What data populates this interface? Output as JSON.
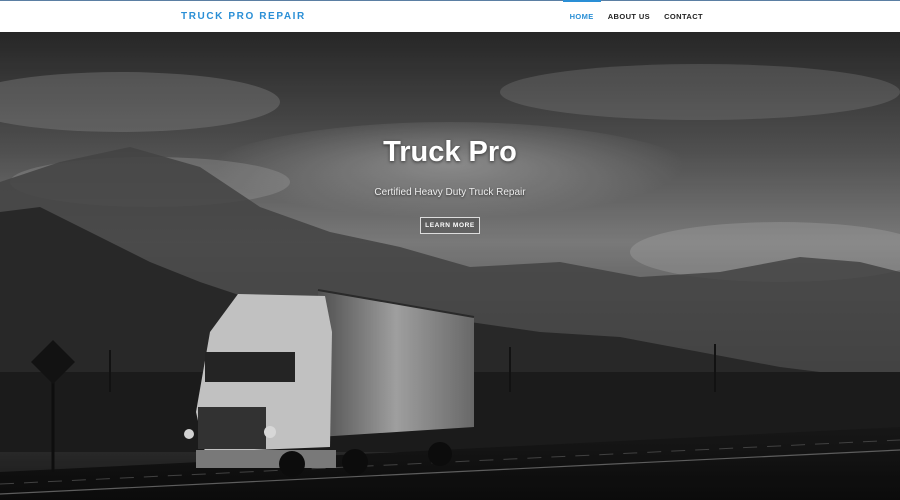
{
  "header": {
    "brand": "TRUCK PRO REPAIR",
    "nav": [
      {
        "label": "HOME",
        "active": true
      },
      {
        "label": "ABOUT US",
        "active": false
      },
      {
        "label": "CONTACT",
        "active": false
      }
    ],
    "accent_color": "#2a8fd6"
  },
  "hero": {
    "title": "Truck Pro",
    "subtitle": "Certified Heavy Duty Truck Repair",
    "cta_label": "LEARN MORE",
    "background_image": "grayscale-semi-truck-mountains-clouds"
  }
}
